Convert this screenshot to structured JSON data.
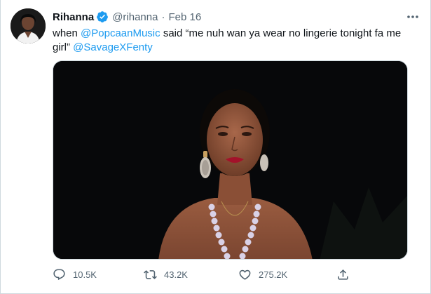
{
  "tweet": {
    "author_name": "Rihanna",
    "handle": "@rihanna",
    "separator": "·",
    "date": "Feb 16",
    "text_before": "when ",
    "mention_1": "@PopcaanMusic",
    "text_middle": " said “me nuh wan ya wear no lingerie tonight fa me girl” ",
    "mention_2": "@SavageXFenty",
    "verified_icon": "verified-badge-icon",
    "more_icon": "more-options-icon"
  },
  "actions": {
    "reply_count": "10.5K",
    "retweet_count": "43.2K",
    "like_count": "275.2K"
  },
  "colors": {
    "link": "#1d9bf0",
    "secondary_text": "#536471",
    "primary_text": "#0f1419",
    "verified": "#1d9bf0"
  }
}
